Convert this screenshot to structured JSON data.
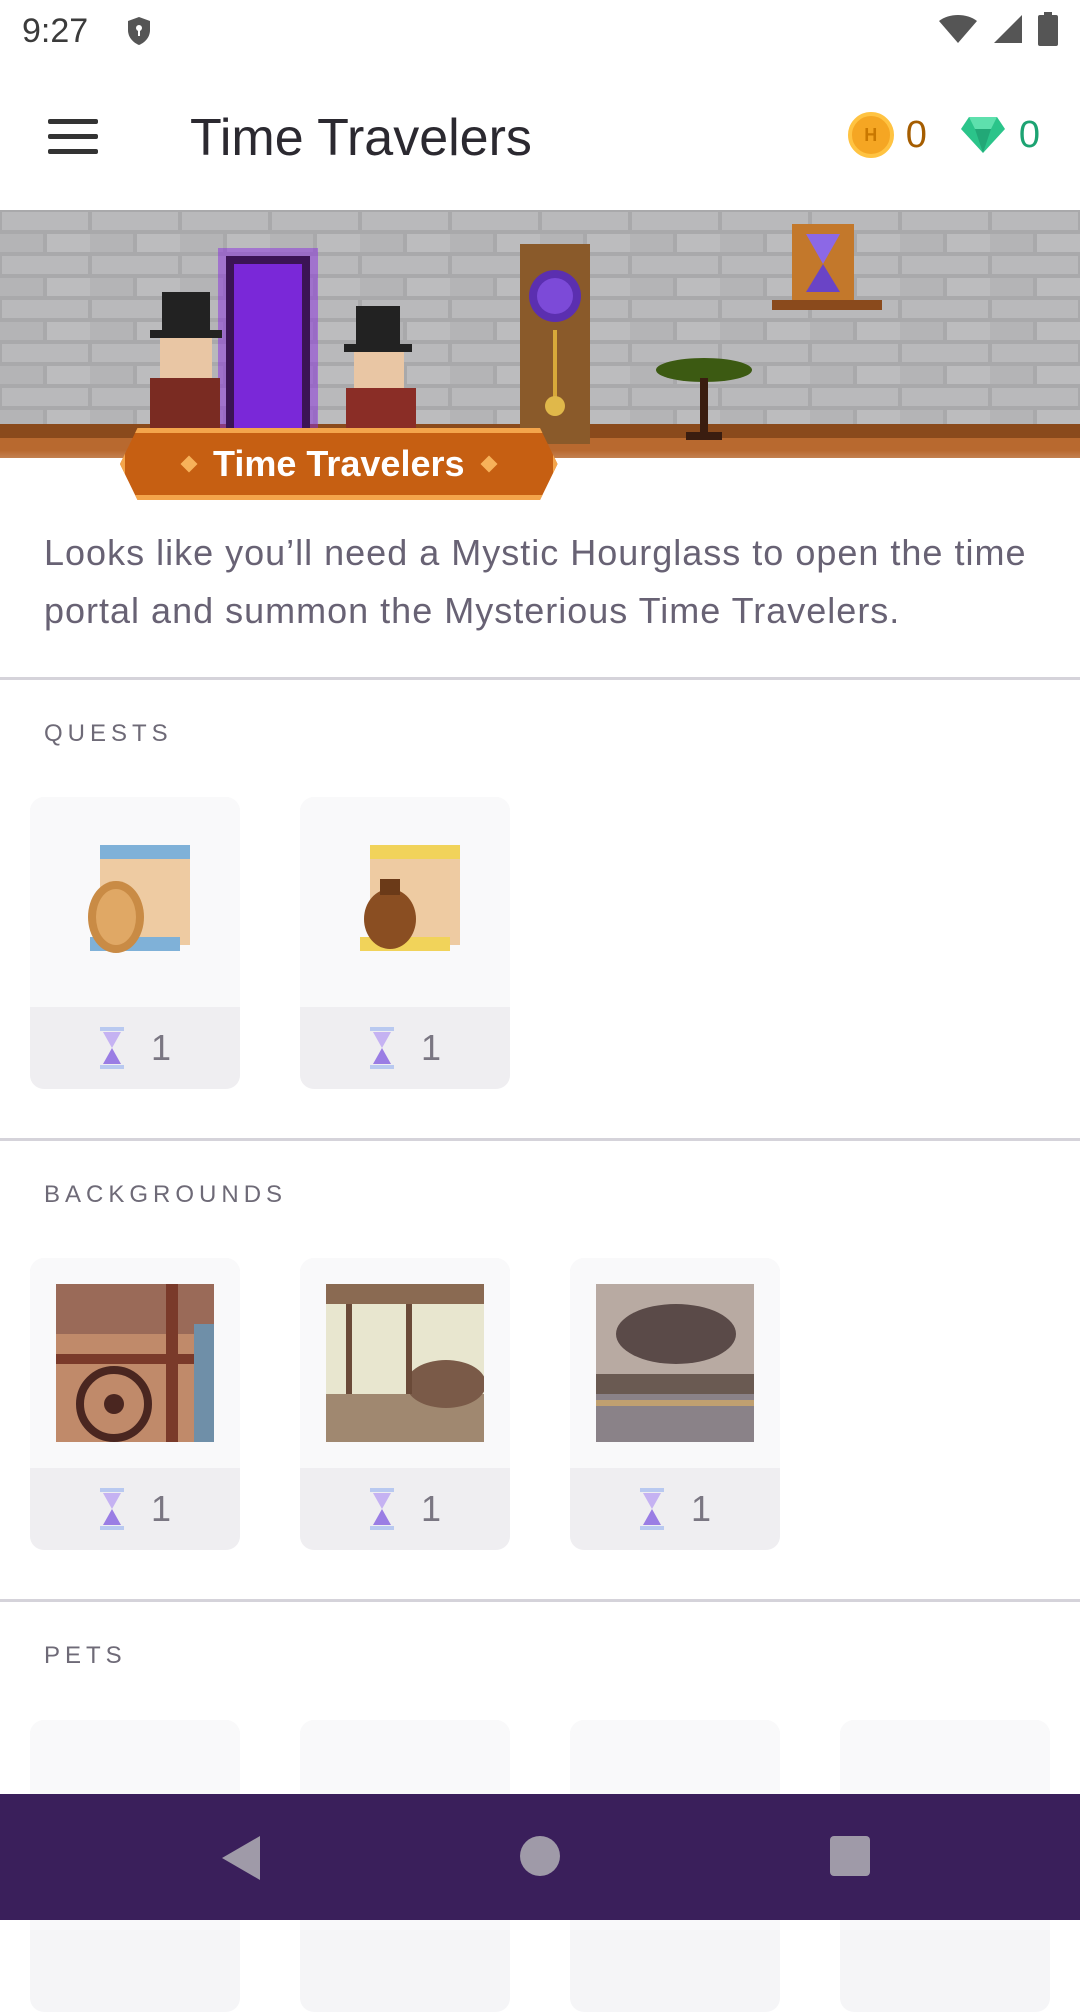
{
  "status_bar": {
    "time": "9:27"
  },
  "toolbar": {
    "title": "Time Travelers",
    "gold": "0",
    "gems": "0"
  },
  "banner": {
    "badge_label": "Time Travelers"
  },
  "description": "Looks like you’ll need a Mystic Hourglass to open the time portal and summon the Mysterious Time Travelers.",
  "sections": {
    "quests": {
      "label": "QUESTS",
      "items": [
        {
          "price": "1"
        },
        {
          "price": "1"
        }
      ]
    },
    "backgrounds": {
      "label": "BACKGROUNDS",
      "items": [
        {
          "price": "1"
        },
        {
          "price": "1"
        },
        {
          "price": "1"
        }
      ]
    },
    "pets": {
      "label": "PETS"
    }
  },
  "colors": {
    "accent_purple": "#3a1f5b",
    "gold": "#a55d00",
    "gem": "#1ca372",
    "badge": "#c65f12"
  }
}
